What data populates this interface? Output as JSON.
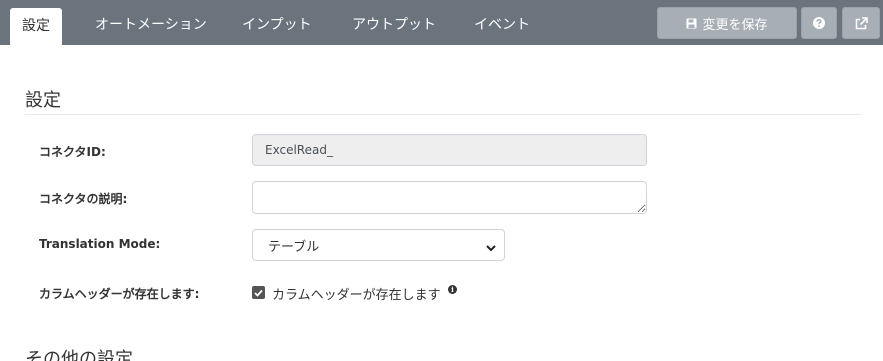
{
  "tabs": [
    {
      "label": "設定",
      "active": true
    },
    {
      "label": "オートメーション",
      "active": false
    },
    {
      "label": "インプット",
      "active": false
    },
    {
      "label": "アウトプット",
      "active": false
    },
    {
      "label": "イベント",
      "active": false
    }
  ],
  "toolbar": {
    "save_label": "変更を保存",
    "save_icon": "floppy-disk-icon",
    "help_icon": "question-circle-icon",
    "external_icon": "external-link-icon"
  },
  "settings": {
    "title": "設定",
    "fields": {
      "connector_id": {
        "label": "コネクタID:",
        "value": "ExcelRead_"
      },
      "description": {
        "label": "コネクタの説明:",
        "value": ""
      },
      "translation_mode": {
        "label": "Translation Mode:",
        "selected": "テーブル"
      },
      "column_header": {
        "label": "カラムヘッダーが存在します:",
        "checkbox_label": "カラムヘッダーが存在します",
        "checked": true
      }
    }
  },
  "other_settings": {
    "title": "その他の設定"
  },
  "colors": {
    "topbar": "#6b737d",
    "button": "#a8aeb5",
    "readonly_field": "#eeeeee",
    "checkbox": "#555555"
  }
}
